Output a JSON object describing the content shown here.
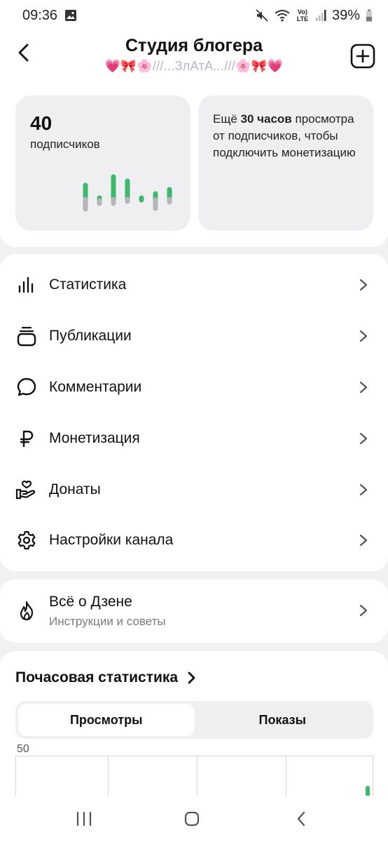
{
  "status_bar": {
    "time": "09:36",
    "network_label": "Vo) LTE",
    "battery": "39%",
    "icons": [
      "gallery-icon",
      "mute-icon",
      "wifi-icon",
      "signal-icon",
      "battery-icon"
    ]
  },
  "header": {
    "title": "Студия блогера",
    "subtitle": "💗🎀🌸///...ЗлАтА...///🌸🎀💗"
  },
  "subscribers_card": {
    "count": "40",
    "label": "подписчиков",
    "accent_color": "#3cb96a"
  },
  "monetization_card": {
    "text_before": "Ещё ",
    "hours": "30 часов",
    "text_after": " просмотра от подписчиков, чтобы подключить монетизацию"
  },
  "menu": {
    "items": [
      {
        "label": "Статистика",
        "icon": "bar-chart-icon"
      },
      {
        "label": "Публикации",
        "icon": "stack-icon"
      },
      {
        "label": "Комментарии",
        "icon": "comment-icon"
      },
      {
        "label": "Монетизация",
        "icon": "ruble-icon"
      },
      {
        "label": "Донаты",
        "icon": "donate-hand-icon"
      },
      {
        "label": "Настройки канала",
        "icon": "gear-icon"
      }
    ]
  },
  "about": {
    "title": "Всё о Дзене",
    "subtitle": "Инструкции и советы",
    "icon": "flame-icon"
  },
  "hourly_stats": {
    "title": "Почасовая статистика",
    "tabs": [
      {
        "label": "Просмотры",
        "active": true
      },
      {
        "label": "Показы",
        "active": false
      }
    ],
    "y_max_label": "50"
  },
  "nav": {
    "icons": [
      "recent-apps-icon",
      "home-icon",
      "back-icon"
    ]
  }
}
